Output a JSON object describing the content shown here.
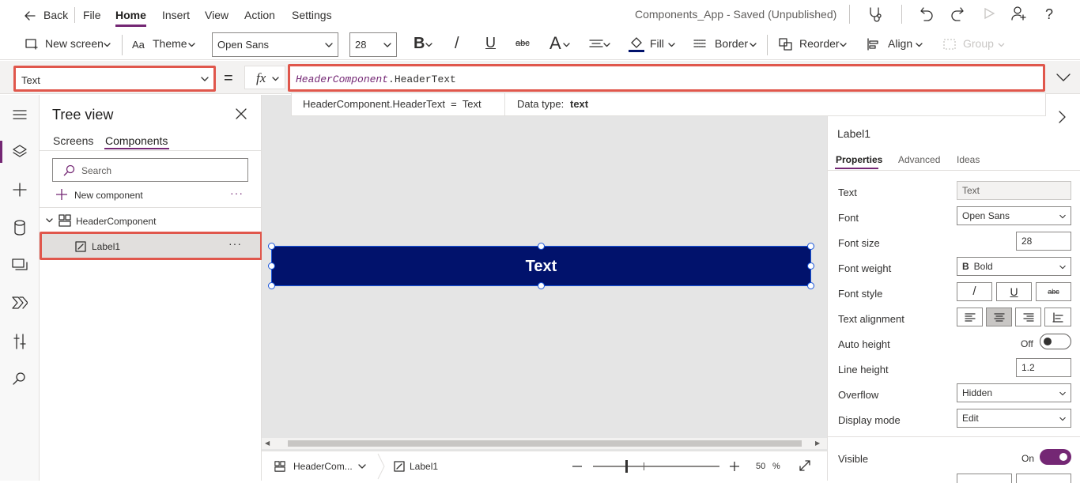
{
  "menubar": {
    "back": "Back",
    "items": [
      "File",
      "Home",
      "Insert",
      "View",
      "Action",
      "Settings"
    ],
    "app_title": "Components_App - Saved (Unpublished)"
  },
  "toolbar": {
    "new_screen": "New screen",
    "theme": "Theme",
    "font_name": "Open Sans",
    "font_size": "28",
    "bold": "B",
    "italic": "/",
    "underline": "U",
    "strike": "abc",
    "font_color": "A",
    "fill": "Fill",
    "border": "Border",
    "reorder": "Reorder",
    "align": "Align",
    "group": "Group"
  },
  "formula": {
    "property": "Text",
    "equals": "=",
    "fx": "fx",
    "expr_object": "HeaderComponent",
    "expr_rest": ".HeaderText",
    "hint_expr": "HeaderComponent.HeaderText  =  Text",
    "hint_type_label": "Data type:",
    "hint_type_value": "text"
  },
  "tree": {
    "title": "Tree view",
    "tabs": [
      "Screens",
      "Components"
    ],
    "search_placeholder": "Search",
    "new_component": "New component",
    "component": "HeaderComponent",
    "child": "Label1"
  },
  "canvas": {
    "label_text": "Text",
    "label_color": "#01126c",
    "breadcrumb_component": "HeaderCom...",
    "breadcrumb_label": "Label1",
    "zoom": "50",
    "zoom_unit": "%"
  },
  "props": {
    "control": "Label1",
    "tabs": [
      "Properties",
      "Advanced",
      "Ideas"
    ],
    "rows": {
      "text_label": "Text",
      "text_value": "Text",
      "font_label": "Font",
      "font_value": "Open Sans",
      "size_label": "Font size",
      "size_value": "28",
      "weight_label": "Font weight",
      "weight_value": "Bold",
      "weight_icon": "B",
      "style_label": "Font style",
      "style_italic": "/",
      "style_underline": "U",
      "style_strike": "abc",
      "align_label": "Text alignment",
      "autoheight_label": "Auto height",
      "autoheight_value": "Off",
      "lineheight_label": "Line height",
      "lineheight_value": "1.2",
      "overflow_label": "Overflow",
      "overflow_value": "Hidden",
      "display_label": "Display mode",
      "display_value": "Edit",
      "visible_label": "Visible",
      "visible_value": "On"
    }
  },
  "colors": {
    "accent": "#742774",
    "highlight": "#e0574c",
    "selection": "#1a56db"
  }
}
